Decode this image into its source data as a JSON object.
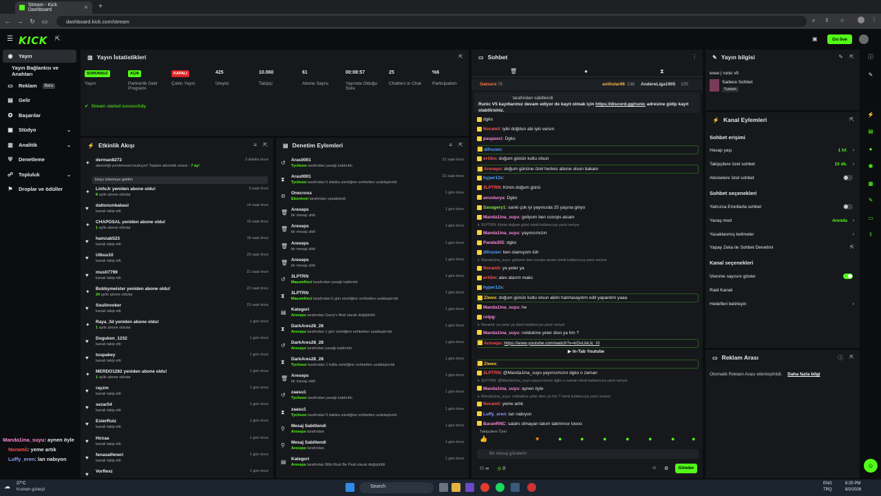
{
  "browser": {
    "tab_title": "Stream - Kick Dashboard",
    "new_tab": "+",
    "url": "dashboard.kick.com/stream"
  },
  "app": {
    "logo": "KICK",
    "go_live": "Go live"
  },
  "nav": {
    "items": [
      {
        "label": "Yayın",
        "active": true
      },
      {
        "label": "Yayın Bağlantısı ve Anahtarı"
      },
      {
        "label": "Reklam",
        "beta": "Beta"
      },
      {
        "label": "Gelir"
      },
      {
        "label": "Başarılar"
      },
      {
        "label": "Stüdyo"
      },
      {
        "label": "Analitik"
      },
      {
        "label": "Denetleme"
      },
      {
        "label": "Topluluk"
      },
      {
        "label": "Droplar ve ödüller"
      }
    ]
  },
  "overlay_chat": [
    {
      "user": "Manda1ina_suyu",
      "text": ": aynen öyle",
      "color": "#ff8ad8"
    },
    {
      "user": "Noramii",
      "text": ": yeme artık",
      "color": "#ff5050"
    },
    {
      "user": "Luffy_eren",
      "text": ": lan nabıyon",
      "color": "#8aa0ff"
    }
  ],
  "stats": {
    "title": "Yayın İstatistikleri",
    "items": [
      {
        "value": "SORUNSUZ",
        "label": "Yayın",
        "badge": "green"
      },
      {
        "value": "AÇIK",
        "label": "Partnerlik Gelir Programı",
        "badge": "green"
      },
      {
        "value": "KAPALI",
        "label": "Çoklu Yayın",
        "badge": "red"
      },
      {
        "value": "425",
        "label": "İzleyici"
      },
      {
        "value": "10.060",
        "label": "Takipçi"
      },
      {
        "value": "61",
        "label": "Abone Sayısı"
      },
      {
        "value": "00:08:57",
        "label": "Yayında Olduğu Süre"
      },
      {
        "value": "25",
        "label": "Chatters in Chat"
      },
      {
        "value": "%6",
        "label": "Participation"
      }
    ],
    "status_message": "Stream started successfully."
  },
  "feed": {
    "title": "Etkinlik Akışı",
    "first": {
      "name": "derman8272",
      "sub": "aboneliği yenilemesini kutluyor! Toplam abonelik süresi -",
      "months": "7 ay!",
      "time": "3 dakika önce",
      "box": "kirayı ödemeye geldim"
    },
    "rows": [
      {
        "icon": "star",
        "name": "LinfoJr yeniden abone oldu!",
        "sub_b": "8",
        "sub": " aylık abone oldular",
        "time": "3 saat önce"
      },
      {
        "icon": "heart",
        "name": "daltonunbabasi",
        "sub": "kanalı takip etti",
        "time": "14 saat önce"
      },
      {
        "icon": "star",
        "name": "CHAPOSAL yeniden abone oldu!",
        "sub_b": "1",
        "sub": " aylık abone oldular",
        "time": "15 saat önce"
      },
      {
        "icon": "heart",
        "name": "hamzab523",
        "sub": "kanalı takip etti",
        "time": "18 saat önce"
      },
      {
        "icon": "heart",
        "name": "Utkuu10",
        "sub": "kanalı takip etti",
        "time": "20 saat önce"
      },
      {
        "icon": "heart",
        "name": "musti7799",
        "sub": "kanalı takip etti",
        "time": "21 saat önce"
      },
      {
        "icon": "star",
        "name": "Bobbymeister yeniden abone oldu!",
        "sub_b": "24",
        "sub": " aylık abone oldular",
        "time": "22 saat önce"
      },
      {
        "icon": "heart",
        "name": "Soulinvoker",
        "sub": "kanalı takip etti",
        "time": "23 saat önce"
      },
      {
        "icon": "star",
        "name": "Raya_3d yeniden abone oldu!",
        "sub_b": "1",
        "sub": " aylık abone oldular",
        "time": "1 gün önce"
      },
      {
        "icon": "heart",
        "name": "Doguken_1232",
        "sub": "kanalı takip etti",
        "time": "1 gün önce"
      },
      {
        "icon": "heart",
        "name": "tospabey",
        "sub": "kanalı takip etti",
        "time": "1 gün önce"
      },
      {
        "icon": "star",
        "name": "MERDO1282 yeniden abone oldu!",
        "sub_b": "1",
        "sub": " aylık abone oldular",
        "time": "1 gün önce"
      },
      {
        "icon": "heart",
        "name": "rayzm",
        "sub": "kanalı takip etti",
        "time": "1 gün önce"
      },
      {
        "icon": "heart",
        "name": "sezar54",
        "sub": "kanalı takip etti",
        "time": "1 gün önce"
      },
      {
        "icon": "heart",
        "name": "EsterRuiz",
        "sub": "kanalı takip etti",
        "time": "1 gün önce"
      },
      {
        "icon": "heart",
        "name": "Hırzaa",
        "sub": "kanalı takip etti",
        "time": "1 gün önce"
      },
      {
        "icon": "heart",
        "name": "fenasalfeneri",
        "sub": "kanalı takip etti",
        "time": "1 gün önce"
      },
      {
        "icon": "heart",
        "name": "Vorflexz",
        "sub": "",
        "time": "1 gün önce"
      }
    ]
  },
  "mod": {
    "title": "Denetim Eylemleri",
    "rows": [
      {
        "icon": "undo",
        "name": "Aras0001",
        "sub_b": "Tychooo",
        "sub": " tarafından yasağı kaldırıldı",
        "time": "21 saat önce"
      },
      {
        "icon": "timer",
        "name": "Aras0001",
        "sub_b": "Tychooo",
        "sub": " tarafından 5 dakika süreliğine sohbetten uzaklaştırıldı",
        "time": "21 saat önce"
      },
      {
        "icon": "ban",
        "name": "Onecross",
        "sub_b": "Ebonivon",
        "sub": " tarafından yasaklandı",
        "time": "1 gün önce"
      },
      {
        "icon": "trash",
        "name": "Areseps",
        "sub": "bir mesajı sildi",
        "time": "1 gün önce"
      },
      {
        "icon": "trash",
        "name": "Areseps",
        "sub": "bir mesajı sildi",
        "time": "1 gün önce"
      },
      {
        "icon": "trash",
        "name": "Areseps",
        "sub": "bir mesajı sildi",
        "time": "1 gün önce"
      },
      {
        "icon": "trash",
        "name": "Areseps",
        "sub": "bir mesajı sildi",
        "time": "1 gün önce"
      },
      {
        "icon": "undo",
        "name": "3LPTRN",
        "sub_b": "MasumKeci",
        "sub": " tarafından yasağı kaldırıldı",
        "time": "1 gün önce"
      },
      {
        "icon": "timer",
        "name": "3LPTRN",
        "sub_b": "MasumKeci",
        "sub": " tarafından 5 gün süreliğine sohbetten uzaklaştırıldı",
        "time": "1 gün önce"
      },
      {
        "icon": "cat",
        "name": "Kategori",
        "sub_b": "Areseps",
        "sub": " tarafından Garry's Mod olarak değiştirildi",
        "time": "1 gün önce"
      },
      {
        "icon": "timer",
        "name": "DarkAres28_28",
        "sub_b": "Areseps",
        "sub": " tarafından 1 gün süreliğine sohbetten uzaklaştırıldı",
        "time": "1 gün önce"
      },
      {
        "icon": "undo",
        "name": "DarkAres28_28",
        "sub_b": "Areseps",
        "sub": " tarafından yasağı kaldırıldı",
        "time": "1 gün önce"
      },
      {
        "icon": "timer",
        "name": "DarkAres28_28",
        "sub_b": "Tychooo",
        "sub": " tarafından 1 hafta süreliğine sohbetten uzaklaştırıldı",
        "time": "1 gün önce"
      },
      {
        "icon": "trash",
        "name": "Areseps",
        "sub": "bir mesajı sildi",
        "time": "1 gün önce"
      },
      {
        "icon": "undo",
        "name": "zaasu1",
        "sub_b": "Tychooo",
        "sub": " tarafından yasağı kaldırıldı",
        "time": "1 gün önce"
      },
      {
        "icon": "timer",
        "name": "zaasu1",
        "sub_b": "Tychooo",
        "sub": " tarafından 5 dakika süreliğine sohbetten uzaklaştırıldı",
        "time": "1 gün önce"
      },
      {
        "icon": "pin",
        "name": "Mesaj Sabitlendi",
        "sub_b": "Areseps",
        "sub": " tarafından",
        "time": "1 gün önce"
      },
      {
        "icon": "pin",
        "name": "Mesaj Sabitlendi",
        "sub_b": "Areseps",
        "sub": " tarafından",
        "time": "1 gün önce"
      },
      {
        "icon": "cat",
        "name": "Kategori",
        "sub_b": "Areseps",
        "sub": " tarafından Bills Must Be Paid olarak değiştirildi",
        "time": "1 gün önce"
      }
    ]
  },
  "chat": {
    "title": "Sohbet",
    "gifters": [
      {
        "name": "Gatsure",
        "count": "75"
      },
      {
        "name": "aniltutar96",
        "count": "136"
      },
      {
        "name": "AndereLiga1905",
        "count": "105"
      }
    ],
    "pinned_by": "tarafından sabitlendi",
    "pinned_text": "Runic V5 kayıtlarımız devam ediyor de kayıt olmak için",
    "pinned_link": "https://discord.gg/runic",
    "pinned_tail": "adresine gidip kayıt olabilirsiniz.",
    "messages": [
      {
        "user": "",
        "text": "dgko",
        "color": "#4aa3ff"
      },
      {
        "user": "Noramii",
        "text": ": iyiki doğdun abi iyki varsın",
        "color": "#ff5050"
      },
      {
        "user": "paspasci",
        "text": ": Dgko",
        "color": "#ff8ad8"
      },
      {
        "user": "difrozen",
        "text": ":",
        "color": "#4aa3ff",
        "hl": true
      },
      {
        "user": "er43m",
        "text": ": doğum günün kutlu olsun",
        "color": "#ff5050"
      },
      {
        "user": "Areseps",
        "text": ": doğum gününe özel herkes abone olsun bakam",
        "color": "#ff5050",
        "hl": true
      },
      {
        "user": "hyper12x",
        "text": ":",
        "color": "#4aa3ff"
      },
      {
        "user": "3LPTRN",
        "text": ": Kimin doğum günü",
        "color": "#ff5050"
      },
      {
        "user": "avusturya",
        "text": ": Dgko",
        "color": "#ff8ad8"
      },
      {
        "user": "Savagery1",
        "text": ": sanki çok iyi yayıncıda 25 yaşına giriyo",
        "color": "#8ae04a"
      },
      {
        "user": "Manda1ina_suyu",
        "text": ": geliyom ben cocops aicam",
        "color": "#ff8ad8"
      },
      {
        "sys": "3LPTRN: Kimin doğum günü isimli kullanıcıya yanıt veriyor"
      },
      {
        "user": "Manda1ina_suyu",
        "text": ": yayıncımızın",
        "color": "#ff8ad8"
      },
      {
        "user": "Panda355",
        "text": ": dgko",
        "color": "#ff8ad8"
      },
      {
        "user": "difrozen",
        "text": ": ben olamıyom tüh",
        "color": "#4aa3ff"
      },
      {
        "sys": "Manda1ina_suyu: geliyom ben cocops aicam isimli kullanıcıya yanıt veriyor"
      },
      {
        "user": "Noramii",
        "text": ": ya yeter ya",
        "color": "#ff5050"
      },
      {
        "user": "er43m",
        "text": ": alev atarım maks",
        "color": "#ff5050"
      },
      {
        "user": "hyper12x",
        "text": ":",
        "color": "#4aa3ff"
      },
      {
        "user": "Ziwex",
        "text": ": doğum günün kutlu olsun abim hatırlasaydım edit yapardım yaaa",
        "color": "#ffd23a",
        "hl": true
      },
      {
        "user": "Manda1ina_suyu",
        "text": ": he",
        "color": "#ff8ad8"
      },
      {
        "user": "rotpg",
        "text": ":",
        "color": "#ff8ad8"
      },
      {
        "sys": "Noramii: ya yeter ya isimli kullanıcıya yanıt veriyor"
      },
      {
        "user": "Manda1ina_suyu",
        "text": ": noldukine yeter dion ya hm ?",
        "color": "#ff8ad8"
      },
      {
        "user": "Areseps",
        "text": ":",
        "color": "#ff5050",
        "link": "https://www.youtube.com/watch?v=kOvLkkJc_I0",
        "hl": true
      },
      {
        "user": "Ziwex",
        "text": ":",
        "color": "#ffd23a",
        "hl": true
      },
      {
        "user": "3LPTRN",
        "text": ": @Manda1ina_suyu yayıncımızın dgko o zaman",
        "color": "#ff5050"
      },
      {
        "sys": "3LPTRN: @Manda1ina_suyu yayıncımızın dgko o zaman isimli kullanıcıya yanıt veriyor"
      },
      {
        "user": "Manda1ina_suyu",
        "text": ": aynen öyle",
        "color": "#ff8ad8"
      },
      {
        "sys": "Manda1ina_suyu: noldukine yeter dion ya hm ? isimli kullanıcıya yanıt veriyor"
      },
      {
        "user": "Noramii",
        "text": ": yeme artık",
        "color": "#ff5050"
      },
      {
        "user": "Luffy_eren",
        "text": ": lan nabıyon",
        "color": "#8aa0ff"
      },
      {
        "user": "BaranRNC",
        "text": ": salahı olmayan takım takmmısr loooo",
        "color": "#ff8ad8"
      }
    ],
    "intab": "In-Tab Youtube",
    "favorites": "Takipçilere Özel",
    "input_placeholder": "Bir mesaj gönderin",
    "send": "Gönder",
    "count_a": "∞",
    "count_b": "0"
  },
  "info": {
    "title": "Yayın bilgisi",
    "stream_title": "exee | runic v5",
    "category": "Sadece Sohbet",
    "language": "Turkish"
  },
  "channel": {
    "title": "Kanal Eylemleri",
    "sec1": "Sohbet erişimi",
    "account_age": "Hesap yaşı",
    "account_age_val": "1 hf.",
    "followers_only": "Takipçilere özel sohbet",
    "followers_only_val": "10 dk.",
    "subs_only": "Abonelere özel sohbet",
    "sec2": "Sohbet seçenekleri",
    "emotes_only": "Yalnızca Emotlarla sohbet",
    "slow": "Yavaş mod",
    "slow_val": "Anında",
    "banned_words": "Yasaklanmış kelimeler",
    "ai_mod": "Yapay Zeka ile Sohbet Denetimi",
    "sec3": "Kanal seçenekleri",
    "show_viewers": "İzlenme sayısını göster",
    "raid": "Raid Kanalı",
    "goals": "Hedefleri belirleyin"
  },
  "ads": {
    "title": "Reklam Arası",
    "text": "Otomatik Reklam Arası etkinleştirildi.",
    "link": "Daha fazla bilgi"
  },
  "taskbar": {
    "temp": "27°C",
    "weather": "Kısmen güneşli",
    "search": "Search",
    "lang": "ENG",
    "lang2": "TRQ",
    "time": "8:25 PM",
    "date": "8/2/2026"
  }
}
